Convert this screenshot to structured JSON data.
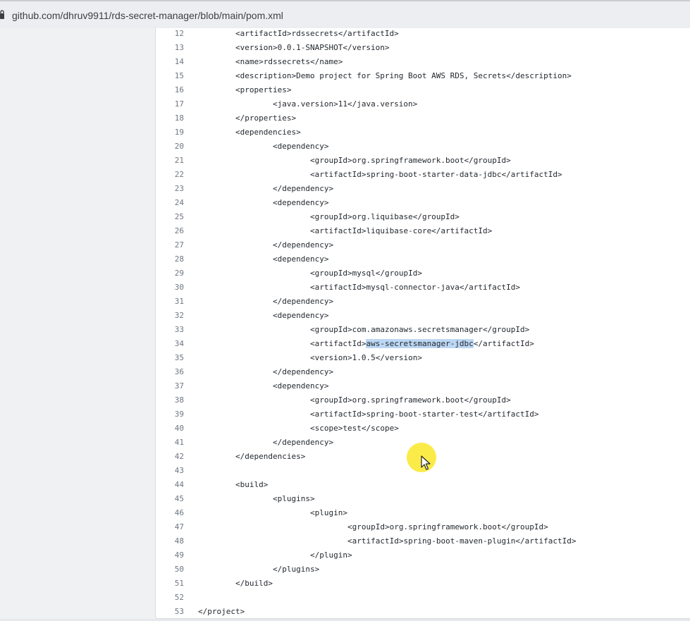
{
  "browser": {
    "url": "github.com/dhruv9911/rds-secret-manager/blob/main/pom.xml"
  },
  "file": {
    "lines": [
      {
        "num": "12",
        "text": "\t<artifactId>rdssecrets</artifactId>"
      },
      {
        "num": "13",
        "text": "\t<version>0.0.1-SNAPSHOT</version>"
      },
      {
        "num": "14",
        "text": "\t<name>rdssecrets</name>"
      },
      {
        "num": "15",
        "text": "\t<description>Demo project for Spring Boot AWS RDS, Secrets</description>"
      },
      {
        "num": "16",
        "text": "\t<properties>"
      },
      {
        "num": "17",
        "text": "\t\t<java.version>11</java.version>"
      },
      {
        "num": "18",
        "text": "\t</properties>"
      },
      {
        "num": "19",
        "text": "\t<dependencies>"
      },
      {
        "num": "20",
        "text": "\t\t<dependency>"
      },
      {
        "num": "21",
        "text": "\t\t\t<groupId>org.springframework.boot</groupId>"
      },
      {
        "num": "22",
        "text": "\t\t\t<artifactId>spring-boot-starter-data-jdbc</artifactId>"
      },
      {
        "num": "23",
        "text": "\t\t</dependency>"
      },
      {
        "num": "24",
        "text": "\t\t<dependency>"
      },
      {
        "num": "25",
        "text": "\t\t\t<groupId>org.liquibase</groupId>"
      },
      {
        "num": "26",
        "text": "\t\t\t<artifactId>liquibase-core</artifactId>"
      },
      {
        "num": "27",
        "text": "\t\t</dependency>"
      },
      {
        "num": "28",
        "text": "\t\t<dependency>"
      },
      {
        "num": "29",
        "text": "\t\t\t<groupId>mysql</groupId>"
      },
      {
        "num": "30",
        "text": "\t\t\t<artifactId>mysql-connector-java</artifactId>"
      },
      {
        "num": "31",
        "text": "\t\t</dependency>"
      },
      {
        "num": "32",
        "text": "\t\t<dependency>"
      },
      {
        "num": "33",
        "text": "\t\t\t<groupId>com.amazonaws.secretsmanager</groupId>"
      },
      {
        "num": "34",
        "text": "\t\t\t<artifactId>aws-secretsmanager-jdbc</artifactId>"
      },
      {
        "num": "35",
        "text": "\t\t\t<version>1.0.5</version>"
      },
      {
        "num": "36",
        "text": "\t\t</dependency>"
      },
      {
        "num": "37",
        "text": "\t\t<dependency>"
      },
      {
        "num": "38",
        "text": "\t\t\t<groupId>org.springframework.boot</groupId>"
      },
      {
        "num": "39",
        "text": "\t\t\t<artifactId>spring-boot-starter-test</artifactId>"
      },
      {
        "num": "40",
        "text": "\t\t\t<scope>test</scope>"
      },
      {
        "num": "41",
        "text": "\t\t</dependency>"
      },
      {
        "num": "42",
        "text": "\t</dependencies>"
      },
      {
        "num": "43",
        "text": ""
      },
      {
        "num": "44",
        "text": "\t<build>"
      },
      {
        "num": "45",
        "text": "\t\t<plugins>"
      },
      {
        "num": "46",
        "text": "\t\t\t<plugin>"
      },
      {
        "num": "47",
        "text": "\t\t\t\t<groupId>org.springframework.boot</groupId>"
      },
      {
        "num": "48",
        "text": "\t\t\t\t<artifactId>spring-boot-maven-plugin</artifactId>"
      },
      {
        "num": "49",
        "text": "\t\t\t</plugin>"
      },
      {
        "num": "50",
        "text": "\t\t</plugins>"
      },
      {
        "num": "51",
        "text": "\t</build>"
      },
      {
        "num": "52",
        "text": ""
      },
      {
        "num": "53",
        "text": "</project>"
      }
    ],
    "selection": {
      "line": "34",
      "text": "aws-secretsmanager-jdbc"
    }
  },
  "colors": {
    "selection": "#bcd7f3",
    "cursor_highlight": "#fae828"
  }
}
